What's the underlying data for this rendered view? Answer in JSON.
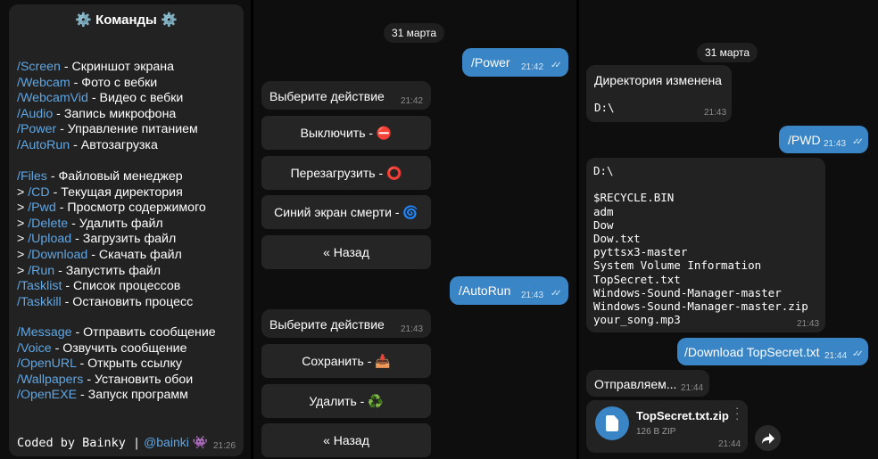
{
  "left": {
    "title": "⚙️ Команды ⚙️",
    "groups": [
      [
        {
          "pre": "",
          "cmd": "/Screen",
          "desc": " -  Скриншот экрана"
        },
        {
          "pre": "",
          "cmd": "/Webcam",
          "desc": " - Фото с вебки"
        },
        {
          "pre": "",
          "cmd": "/WebcamVid",
          "desc": " - Видео с вебки"
        },
        {
          "pre": "",
          "cmd": "/Audio",
          "desc": " - Запись микрофона"
        },
        {
          "pre": "",
          "cmd": "/Power",
          "desc": " - Управление питанием"
        },
        {
          "pre": "",
          "cmd": "/AutoRun",
          "desc": " - Автозагрузка"
        }
      ],
      [
        {
          "pre": "",
          "cmd": "/Files",
          "desc": " - Файловый менеджер"
        },
        {
          "pre": "> ",
          "cmd": "/CD",
          "desc": " - Текущая директория"
        },
        {
          "pre": "> ",
          "cmd": "/Pwd",
          "desc": " - Просмотр содержимого"
        },
        {
          "pre": "> ",
          "cmd": "/Delete",
          "desc": " - Удалить файл"
        },
        {
          "pre": "> ",
          "cmd": "/Upload",
          "desc": " - Загрузить файл"
        },
        {
          "pre": "> ",
          "cmd": "/Download",
          "desc": " - Скачать файл"
        },
        {
          "pre": "> ",
          "cmd": "/Run",
          "desc": " - Запустить файл"
        },
        {
          "pre": "",
          "cmd": "/Tasklist",
          "desc": " - Список процессов"
        },
        {
          "pre": "",
          "cmd": "/Taskkill",
          "desc": " - Остановить процесс"
        }
      ],
      [
        {
          "pre": "",
          "cmd": "/Message",
          "desc": " - Отправить сообщение"
        },
        {
          "pre": "",
          "cmd": "/Voice",
          "desc": " - Озвучить сообщение"
        },
        {
          "pre": "",
          "cmd": "/OpenURL",
          "desc": " - Открыть ссылку"
        },
        {
          "pre": "",
          "cmd": "/Wallpapers",
          "desc": " - Установить обои"
        },
        {
          "pre": "",
          "cmd": "/OpenEXE",
          "desc": " - Запуск программ"
        }
      ]
    ],
    "footer_text": "Coded by Bainky |",
    "footer_link": "@bainki",
    "footer_emoji": "👾",
    "time": "21:26"
  },
  "middle": {
    "date": "31 марта",
    "msg_power": {
      "text": "/Power",
      "time": "21:42"
    },
    "choose1": {
      "text": "Выберите действие",
      "time": "21:42"
    },
    "buttons1": [
      "Выключить - ⛔",
      "Перезагрузить - ⭕",
      "Синий экран смерти - 🌀",
      "« Назад"
    ],
    "msg_autorun": {
      "text": "/AutoRun",
      "time": "21:43"
    },
    "choose2": {
      "text": "Выберите действие",
      "time": "21:43"
    },
    "buttons2": [
      "Сохранить - 📥",
      "Удалить - ♻️",
      "« Назад"
    ]
  },
  "right": {
    "date": "31 марта",
    "dir_changed": {
      "line1": "Директория изменена",
      "line2": "D:\\",
      "time": "21:43"
    },
    "msg_pwd": {
      "text": "/PWD",
      "time": "21:43"
    },
    "listing": {
      "lines": [
        "D:\\",
        "",
        "$RECYCLE.BIN",
        "adm",
        "Dow",
        "Dow.txt",
        "pyttsx3-master",
        "System Volume Information",
        "TopSecret.txt",
        "Windows-Sound-Manager-master",
        "Windows-Sound-Manager-master.zip",
        "your_song.mp3"
      ],
      "time": "21:43"
    },
    "msg_download": {
      "text": "/Download TopSecret.txt",
      "time": "21:44"
    },
    "sending": {
      "text": "Отправляем...",
      "time": "21:44"
    },
    "file": {
      "name": "TopSecret.txt.zip",
      "meta": "126 B ZIP",
      "time": "21:44"
    }
  },
  "colors": {
    "link": "#5fa6e3",
    "outgoing": "#3a85c5",
    "bubble": "#222222",
    "bg": "#0e0e0e"
  }
}
